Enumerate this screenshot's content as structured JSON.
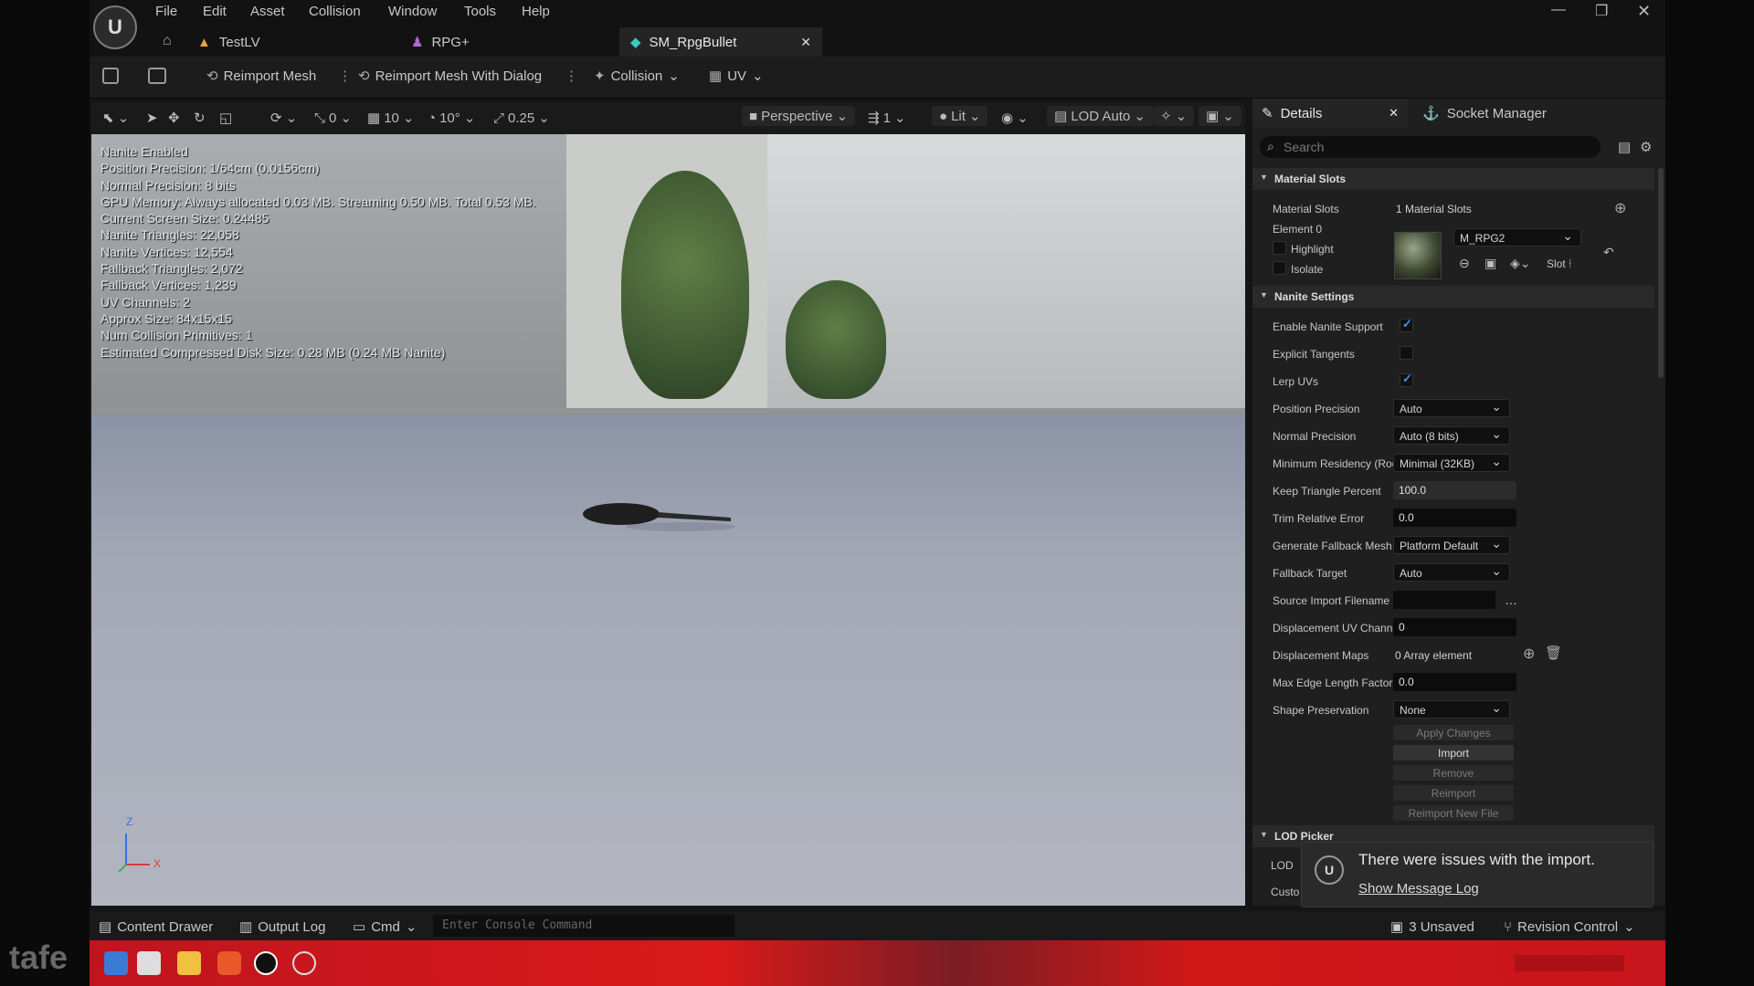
{
  "menu": [
    "File",
    "Edit",
    "Asset",
    "Collision",
    "Window",
    "Tools",
    "Help"
  ],
  "tabs": [
    "TestLV",
    "RPG+",
    "SM_RpgBullet"
  ],
  "toolbar": {
    "reimport": "Reimport Mesh",
    "reimport_dialog": "Reimport Mesh With Dialog",
    "collision": "Collision",
    "uv": "UV"
  },
  "viewport_toolbar": {
    "rotation_snap": "0",
    "grid_snap": "10",
    "angle_snap": "10°",
    "scale_snap": "0.25",
    "view_mode": "Perspective",
    "camera_speed": "1",
    "lighting": "Lit",
    "lod": "LOD Auto"
  },
  "stats": [
    "Nanite Enabled",
    "Position Precision: 1/64cm (0.0156cm)",
    "Normal Precision: 8 bits",
    "GPU Memory: Always allocated 0.03 MB. Streaming 0.50 MB. Total 0.53 MB.",
    "Current Screen Size: 0.24485",
    "Nanite Triangles: 22,058",
    "Nanite Vertices: 12,554",
    "Fallback Triangles: 2,072",
    "Fallback Vertices: 1,239",
    "UV Channels: 2",
    "Approx Size: 84x15x15",
    "Num Collision Primitives: 1",
    "Estimated Compressed Disk Size: 0.28 MB (0.24 MB Nanite)"
  ],
  "axis": {
    "z": "Z",
    "x": "X"
  },
  "details": {
    "tab_details": "Details",
    "tab_socket": "Socket Manager",
    "search_placeholder": "Search",
    "material_section": "Material Slots",
    "material_slots_label": "Material Slots",
    "material_slots_value": "1 Material Slots",
    "element0": "Element 0",
    "highlight": "Highlight",
    "isolate": "Isolate",
    "material_name": "M_RPG2",
    "slot": "Slot",
    "nanite_section": "Nanite Settings",
    "enable_nanite": "Enable Nanite Support",
    "explicit_tangents": "Explicit Tangents",
    "lerp_uvs": "Lerp UVs",
    "position_precision": "Position Precision",
    "position_precision_value": "Auto",
    "normal_precision": "Normal Precision",
    "normal_precision_value": "Auto (8 bits)",
    "min_residency": "Minimum Residency (Root (",
    "min_residency_value": "Minimal (32KB)",
    "keep_triangle": "Keep Triangle Percent",
    "keep_triangle_value": "100.0",
    "trim_error": "Trim Relative Error",
    "trim_error_value": "0.0",
    "gen_fallback": "Generate Fallback Mesh",
    "gen_fallback_value": "Platform Default",
    "fallback_target": "Fallback Target",
    "fallback_target_value": "Auto",
    "source_import": "Source Import Filename",
    "source_import_value": "",
    "disp_uv": "Displacement UV Channel",
    "disp_uv_value": "0",
    "disp_maps": "Displacement Maps",
    "disp_maps_value": "0 Array element",
    "max_edge": "Max Edge Length Factor",
    "max_edge_value": "0.0",
    "shape_pres": "Shape Preservation",
    "shape_pres_value": "None",
    "btn_apply": "Apply Changes",
    "btn_import": "Import",
    "btn_remove": "Remove",
    "btn_reimport": "Reimport",
    "btn_reimport_new": "Reimport New File",
    "lod_section": "LOD Picker",
    "lod_label": "LOD",
    "custom_label": "Custo"
  },
  "toast": {
    "message": "There were issues with the import.",
    "link": "Show Message Log"
  },
  "bottom": {
    "content_drawer": "Content Drawer",
    "output_log": "Output Log",
    "cmd": "Cmd",
    "console_placeholder": "Enter Console Command",
    "unsaved": "3 Unsaved",
    "revision": "Revision Control"
  },
  "watermark": "tafe"
}
